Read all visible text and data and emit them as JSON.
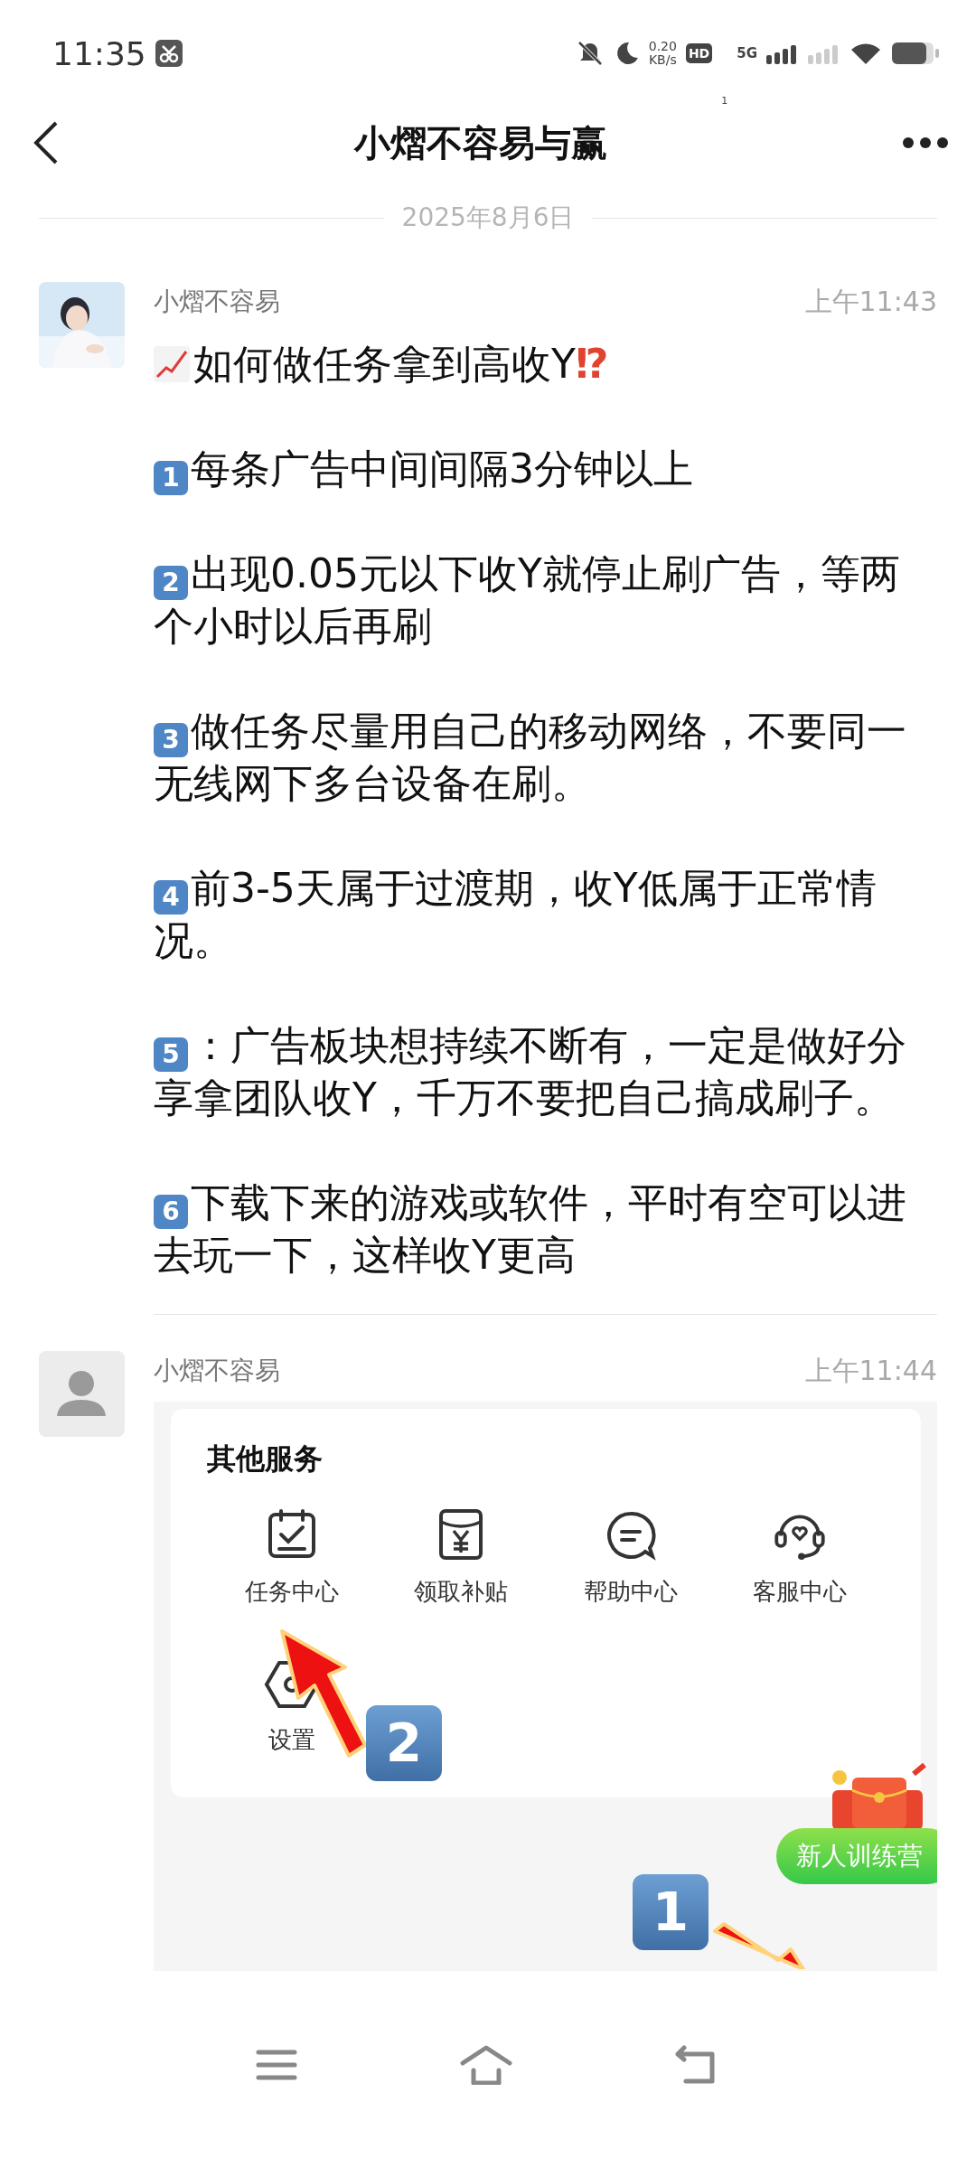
{
  "status_bar": {
    "time": "11:35",
    "speed_value": "0.20",
    "speed_unit": "KB/s",
    "hd_label": "HD",
    "hd_sub": "1",
    "net_label": "5G"
  },
  "header": {
    "title": "小熠不容易与赢"
  },
  "date_divider": "2025年8月6日",
  "messages": [
    {
      "kind": "text",
      "sender": "小熠不容易",
      "time": "上午11:43",
      "title": {
        "text": "如何做任务拿到高收Y",
        "mark": "⁉"
      },
      "paragraphs": [
        {
          "badge": "1",
          "text": "每条广告中间间隔3分钟以上"
        },
        {
          "badge": "2",
          "text": "出现0.05元以下收Y就停止刷广告，等两个小时以后再刷"
        },
        {
          "badge": "3",
          "text": "做任务尽量用自己的移动网络，不要同一无线网下多台设备在刷。"
        },
        {
          "badge": "4",
          "text": "前3-5天属于过渡期，收Y低属于正常情况。"
        },
        {
          "badge": "5",
          "text": "：广告板块想持续不断有，一定是做好分享拿团队收Y，千万不要把自己搞成刷子。"
        },
        {
          "badge": "6",
          "text": "下载下来的游戏或软件，平时有空可以进去玩一下，这样收Y更高"
        }
      ]
    },
    {
      "sender": "小熠不容易",
      "time": "上午11:44",
      "screenshot": {
        "section_title": "其他服务",
        "services": [
          {
            "kind": "task",
            "label": "任务中心"
          },
          {
            "kind": "subsidy",
            "label": "领取补贴"
          },
          {
            "kind": "help",
            "label": "帮助中心"
          },
          {
            "kind": "support",
            "label": "客服中心"
          },
          {
            "kind": "settings",
            "label": "设置"
          }
        ],
        "step_badges": [
          "2",
          "1"
        ],
        "promo_button": "新人训练营"
      }
    }
  ]
}
